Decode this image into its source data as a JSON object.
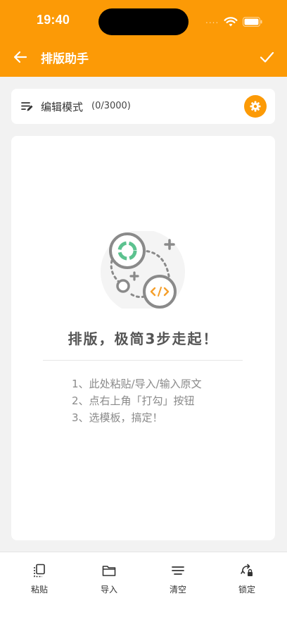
{
  "status_bar": {
    "time": "19:40",
    "signal": "....",
    "icons": [
      "wifi-icon",
      "battery-icon"
    ]
  },
  "nav": {
    "title": "排版助手",
    "back_icon": "arrow-left-icon",
    "confirm_icon": "check-icon"
  },
  "mode_bar": {
    "label": "编辑模式",
    "count": "(0/3000)",
    "icon": "edit-lines-icon",
    "settings_icon": "gear-icon"
  },
  "editor": {
    "empty_title": "排版，极简3步走起！",
    "steps": [
      "1、此处粘贴/导入/输入原文",
      "2、点右上角「打勾」按钮",
      "3、选模板，搞定！"
    ]
  },
  "toolbar": {
    "items": [
      {
        "label": "粘贴",
        "icon": "paste-icon"
      },
      {
        "label": "导入",
        "icon": "folder-icon"
      },
      {
        "label": "清空",
        "icon": "clear-lines-icon"
      },
      {
        "label": "锁定",
        "icon": "lock-rotate-icon"
      }
    ]
  },
  "colors": {
    "accent": "#fc9a06",
    "background": "#f2f2f2",
    "card": "#ffffff"
  }
}
